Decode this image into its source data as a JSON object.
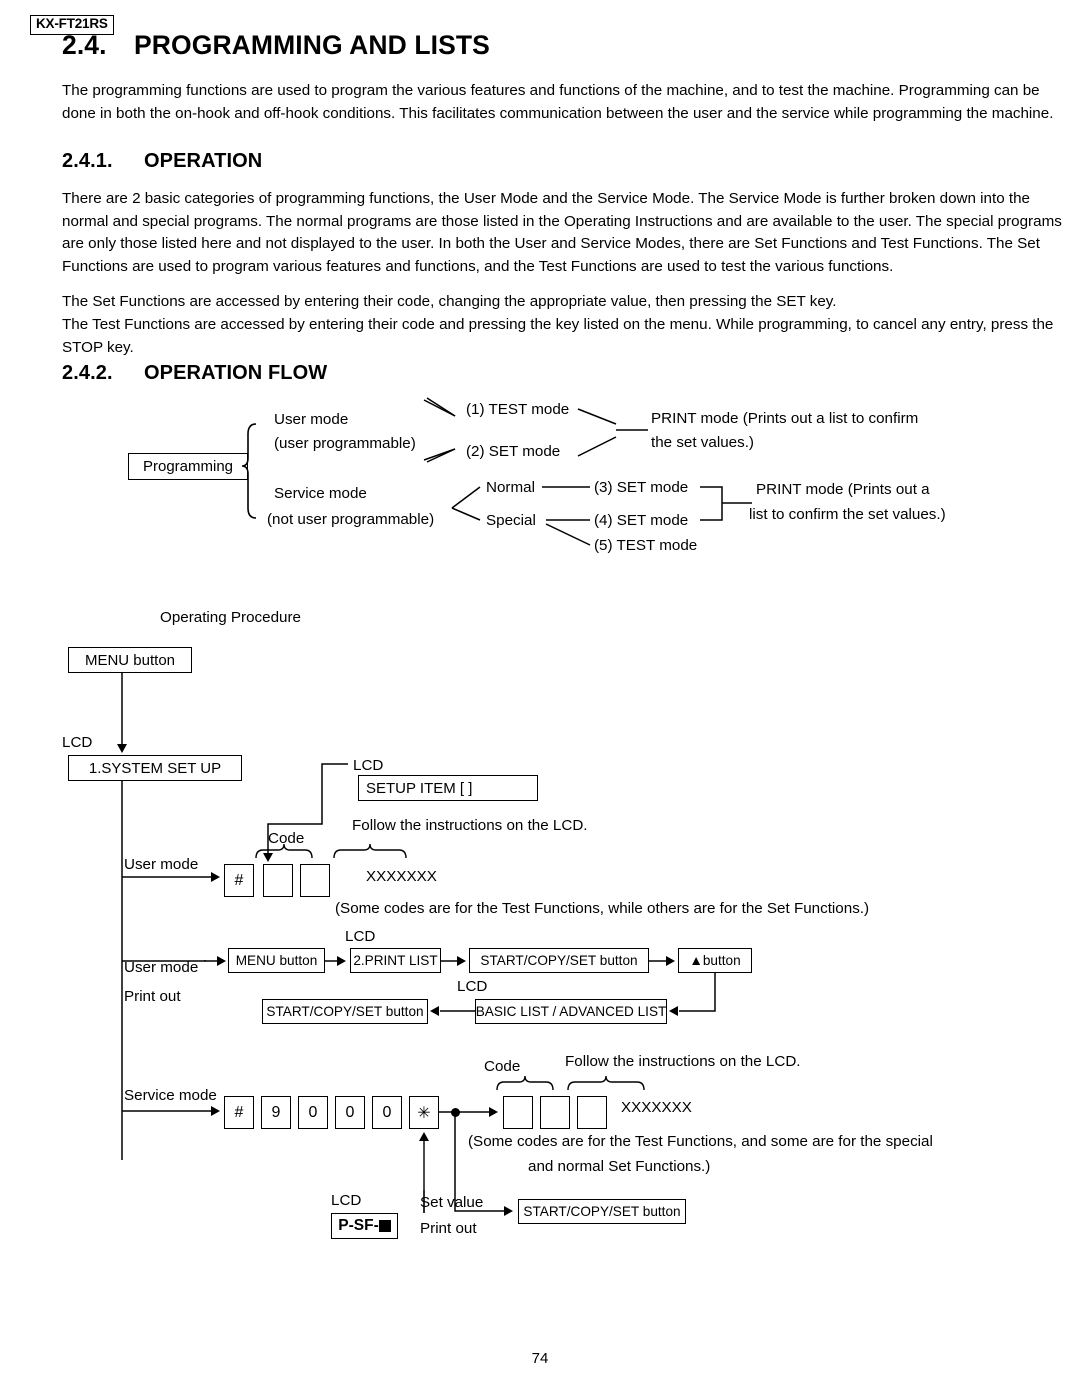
{
  "model_badge": "KX-FT21RS",
  "page_number": "74",
  "heading": {
    "number": "2.4.",
    "title": "PROGRAMMING AND LISTS"
  },
  "intro_paragraph": "The programming functions are used to program the various features and functions of the machine, and to test the machine. Programming can be done in both the on-hook and off-hook conditions. This facilitates communication between the user and the service while programming the machine.",
  "section_operation": {
    "number": "2.4.1.",
    "title": "OPERATION",
    "paragraph_1": "There are 2 basic categories of programming functions, the User Mode and the Service Mode. The Service Mode is further broken down into the normal and special programs. The normal programs are those listed in the Operating Instructions and are available to the user. The special programs are only those listed here and not displayed to the user. In both the User and Service Modes, there are Set Functions and Test Functions. The Set Functions are used to program various features and functions, and the Test Functions are used to test the various functions.",
    "paragraph_2": "The Set Functions are accessed by entering their code, changing the appropriate value, then pressing the SET key.",
    "paragraph_3": "The Test Functions are accessed by entering their code and pressing the key listed on the menu. While programming, to cancel any entry, press the STOP key."
  },
  "section_operation_flow": {
    "number": "2.4.2.",
    "title": "OPERATION FLOW"
  },
  "tree_diagram": {
    "root": "Programming",
    "user_mode_line1": "User mode",
    "user_mode_line2": "(user programmable)",
    "service_mode_line1": "Service mode",
    "service_mode_line2": "(not user programmable)",
    "mode_1": "(1) TEST mode",
    "mode_2": "(2) SET mode",
    "normal": "Normal",
    "special": "Special",
    "mode_3": "(3) SET mode",
    "mode_4": "(4) SET mode",
    "mode_5": "(5) TEST mode",
    "print_upper_line1": "PRINT mode (Prints out a list to confirm",
    "print_upper_line2": "the set values.)",
    "print_lower_line1": "PRINT mode (Prints out a",
    "print_lower_line2": "list to confirm the set values.)"
  },
  "procedure": {
    "title": "Operating Procedure",
    "menu_button": "MENU button",
    "lcd_label": "LCD",
    "lcd_system_setup": "1.SYSTEM SET UP",
    "lcd_setup_item": "SETUP ITEM [            ]",
    "code_label": "Code",
    "follow_instructions": "Follow the instructions on the LCD.",
    "user_mode_label": "User mode",
    "hash_key": "#",
    "xxxxxxx": "XXXXXXX",
    "note_user": "(Some codes are for the Test Functions, while others are for the Set Functions.)",
    "print_out_label": "Print out",
    "print_list": "2.PRINT LIST",
    "start_copy_set_button": "START/COPY/SET button",
    "up_button": "▲button",
    "basic_advanced_list": "BASIC LIST / ADVANCED LIST",
    "service_mode_label": "Service mode",
    "service_keys": [
      "#",
      "9",
      "0",
      "0",
      "0",
      "✳"
    ],
    "note_service_line1": "(Some codes are for the Test Functions, and some are for the special",
    "note_service_line2": "and normal Set Functions.)",
    "lcd_psf": "P-SF-",
    "set_value_label": "Set value",
    "print_out_label2": "Print out"
  }
}
